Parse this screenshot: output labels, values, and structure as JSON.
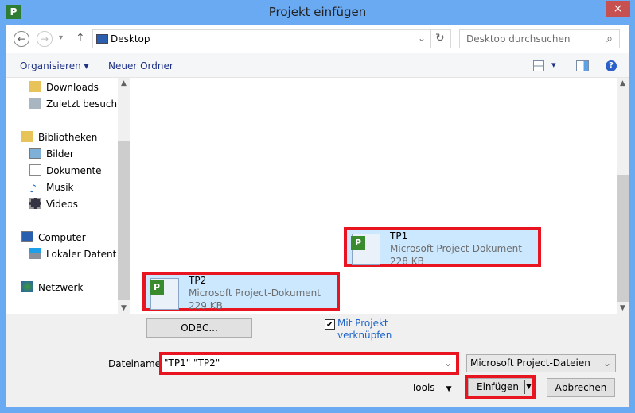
{
  "window": {
    "title": "Projekt einfügen",
    "close": "×",
    "app_icon": "P"
  },
  "address": {
    "back": "←",
    "forward": "→",
    "recent": "▾",
    "up": "↑",
    "location": "Desktop",
    "refresh": "↻",
    "dropdown": "⌄"
  },
  "search": {
    "placeholder": "Desktop durchsuchen",
    "icon": "⌕"
  },
  "toolbar": {
    "organize": "Organisieren ▾",
    "new_folder": "Neuer Ordner",
    "view_dropdown": "▾",
    "help": "?"
  },
  "nav": {
    "items": [
      {
        "label": "Downloads",
        "icon": "downloads-folder-icon"
      },
      {
        "label": "Zuletzt besucht",
        "icon": "recent-places-icon"
      },
      {
        "label": "Bibliotheken",
        "icon": "libraries-icon"
      },
      {
        "label": "Bilder",
        "icon": "pictures-icon"
      },
      {
        "label": "Dokumente",
        "icon": "documents-icon"
      },
      {
        "label": "Musik",
        "icon": "music-icon"
      },
      {
        "label": "Videos",
        "icon": "videos-icon"
      },
      {
        "label": "Computer",
        "icon": "computer-icon"
      },
      {
        "label": "Lokaler Datenträger",
        "icon": "local-disk-icon"
      },
      {
        "label": "Netzwerk",
        "icon": "network-icon"
      }
    ]
  },
  "files": [
    {
      "name": "TP1",
      "type": "Microsoft Project-Dokument",
      "size": "228 KB"
    },
    {
      "name": "TP2",
      "type": "Microsoft Project-Dokument",
      "size": "229 KB"
    }
  ],
  "bottom": {
    "odbc": "ODBC...",
    "link_check_label_1": "Mit Projekt",
    "link_check_label_2": "verknüpfen",
    "link_checked": true,
    "filename_label": "Dateiname:",
    "filename_value": "\"TP1\" \"TP2\"",
    "filetype": "Microsoft Project-Dateien",
    "tools": "Tools",
    "insert": "Einfügen",
    "cancel": "Abbrechen"
  },
  "colors": {
    "highlight": "#e8141f",
    "selection": "#cce8ff",
    "link": "#1e64c8"
  }
}
